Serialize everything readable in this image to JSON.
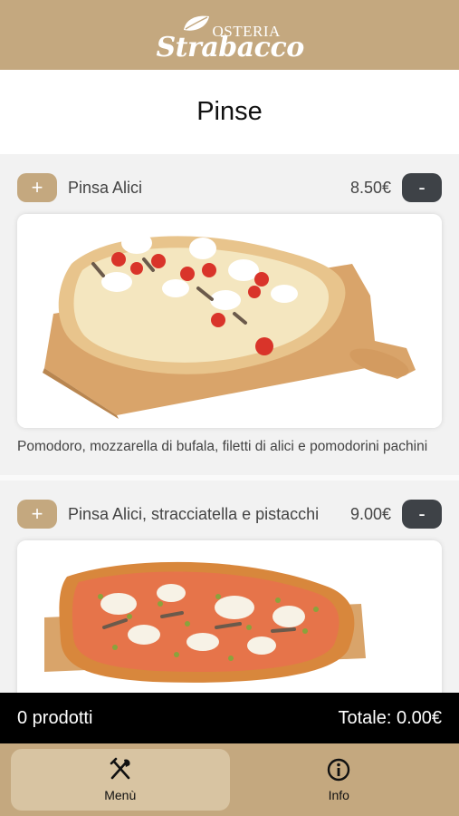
{
  "header": {
    "logo_top": "OSTERIA",
    "logo_bottom": "Strabacco"
  },
  "page": {
    "title": "Pinse"
  },
  "products": [
    {
      "name": "Pinsa Alici",
      "price": "8.50€",
      "add_label": "+",
      "remove_label": "-",
      "description": "Pomodoro, mozzarella di bufala, filetti di alici e pomodorini pachini"
    },
    {
      "name": "Pinsa Alici, stracciatella e pistacchi",
      "price": "9.00€",
      "add_label": "+",
      "remove_label": "-"
    }
  ],
  "cart": {
    "count": "0 prodotti",
    "total": "Totale: 0.00€"
  },
  "nav": {
    "menu_label": "Menù",
    "info_label": "Info",
    "menu_icon": "fork-knife-icon",
    "info_icon": "info-icon"
  },
  "colors": {
    "brand": "#c4a87f",
    "dark": "#3e4247",
    "cart_bar": "#000000"
  }
}
